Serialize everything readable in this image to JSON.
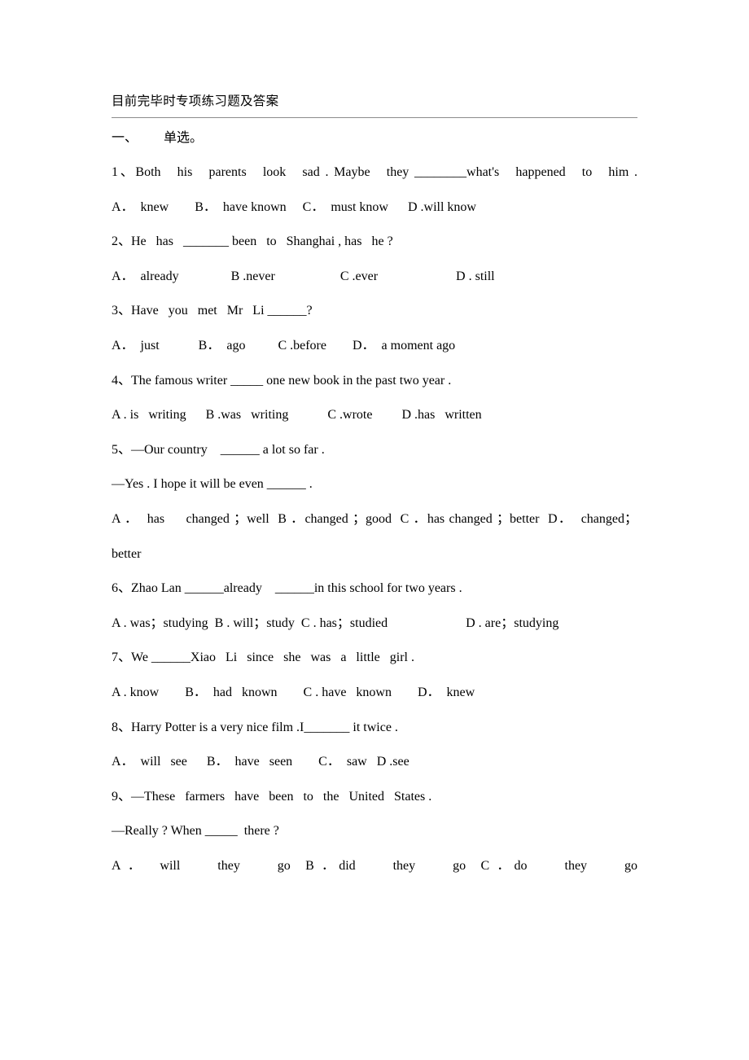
{
  "document": {
    "title": "目前完毕时专项练习题及答案",
    "section_heading": "一、        单选。",
    "items": [
      {
        "id": "q1",
        "kind": "question",
        "number": "1、",
        "text": "1、Both   his   parents   look   sad . Maybe   they ________what's   happened   to   him .",
        "justify": "justify-all"
      },
      {
        "id": "q1-options",
        "kind": "options",
        "text": "A．  knew        B．  have known     C．  must know      D .will know",
        "justify": "left-last"
      },
      {
        "id": "q2",
        "kind": "question",
        "number": "2、",
        "text": "2、He   has   _______ been   to   Shanghai , has   he ?",
        "justify": "left-last"
      },
      {
        "id": "q2-options",
        "kind": "options",
        "text": "A．  already                B .never                    C .ever                        D . still",
        "justify": "left-last"
      },
      {
        "id": "q3",
        "kind": "question",
        "number": "3、",
        "text": "3、Have   you   met   Mr   Li ______?",
        "justify": "left-last"
      },
      {
        "id": "q3-options",
        "kind": "options",
        "text": "A．  just            B．  ago          C .before        D．  a moment ago",
        "justify": "left-last"
      },
      {
        "id": "q4",
        "kind": "question",
        "number": "4、",
        "text": "4、The famous writer _____ one new book in the past two year .",
        "justify": "left-last"
      },
      {
        "id": "q4-options",
        "kind": "options",
        "text": "A . is   writing      B .was   writing            C .wrote         D .has   written",
        "justify": "left-last"
      },
      {
        "id": "q5",
        "kind": "question",
        "number": "5、",
        "text": "5、—Our country    ______ a lot so far .",
        "justify": "left-last"
      },
      {
        "id": "q5-reply",
        "kind": "dialogue",
        "text": "—Yes . I hope it will be even ______ .",
        "justify": "left-last"
      },
      {
        "id": "q5-options",
        "kind": "options",
        "text": "A ．  has     changed ；well  B ．changed ；good  C ．has changed ；better  D．  changed；better",
        "justify": "justify-all"
      },
      {
        "id": "q6",
        "kind": "question",
        "number": "6、",
        "text": "6、Zhao Lan ______already    ______in this school for two years .",
        "justify": "left-last"
      },
      {
        "id": "q6-options",
        "kind": "options",
        "text": "A . was；studying  B . will；study  C . has；studied                        D . are；studying",
        "justify": "left-last"
      },
      {
        "id": "q7",
        "kind": "question",
        "number": "7、",
        "text": "7、We ______Xiao   Li   since   she   was   a   little   girl .",
        "justify": "left-last"
      },
      {
        "id": "q7-options",
        "kind": "options",
        "text": "A . know        B．  had   known        C . have   known        D．  knew",
        "justify": "left-last"
      },
      {
        "id": "q8",
        "kind": "question",
        "number": "8、",
        "text": "8、Harry Potter is a very nice film .I_______ it twice .",
        "justify": "left-last"
      },
      {
        "id": "q8-options",
        "kind": "options",
        "text": "A．  will   see      B．  have   seen        C．  saw   D .see",
        "justify": "left-last"
      },
      {
        "id": "q9",
        "kind": "question",
        "number": "9、",
        "text": "9、—These   farmers   have   been   to   the   United   States .",
        "justify": "left-last"
      },
      {
        "id": "q9-reply",
        "kind": "dialogue",
        "text": "—Really ? When _____  there ?",
        "justify": "left-last"
      },
      {
        "id": "q9-options",
        "kind": "options",
        "text": "A ．  will     they     go  B ．did     they     go  C ．do     they     go",
        "justify": "justify-all"
      }
    ]
  },
  "style": {
    "rule_color": "#8c8c8c",
    "text_color": "#000000",
    "page_background": "#ffffff"
  }
}
